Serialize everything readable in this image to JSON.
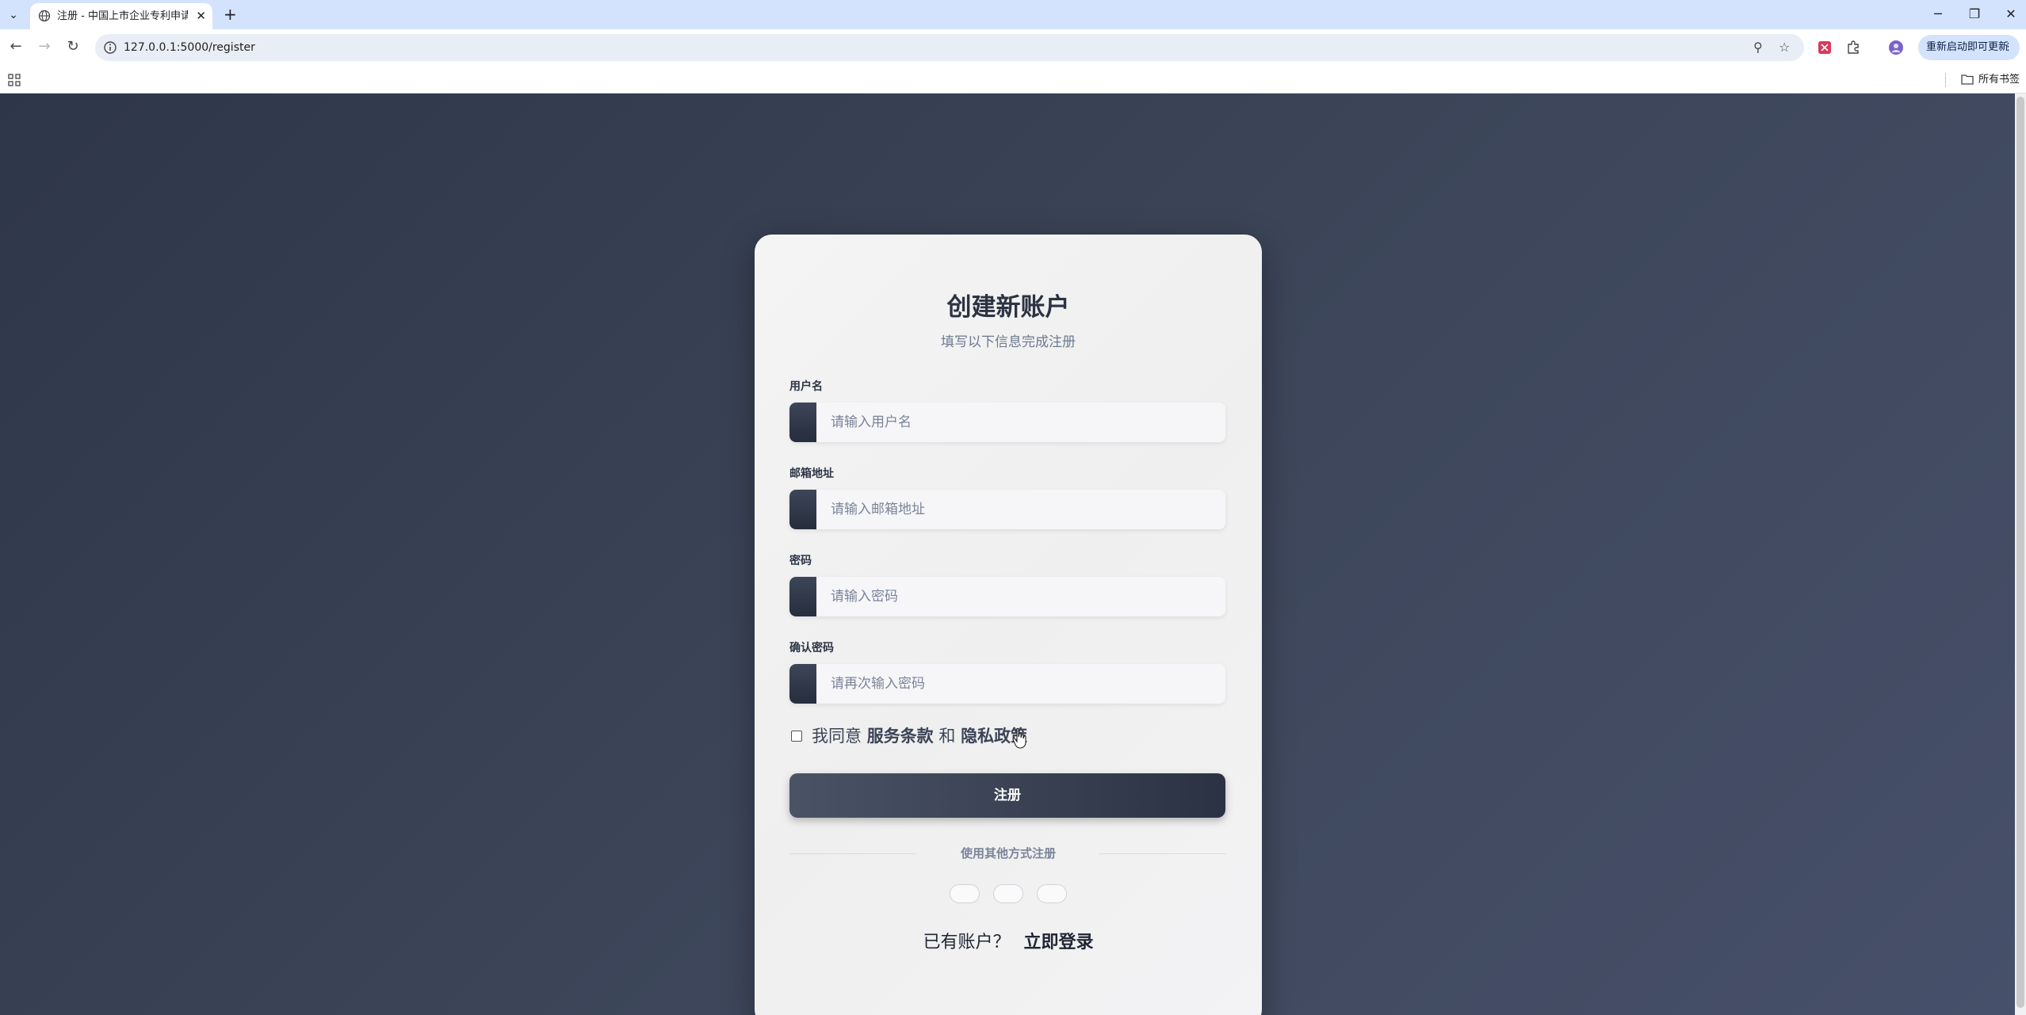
{
  "browser": {
    "tab_title": "注册 - 中国上市企业专利申请数据",
    "url": "127.0.0.1:5000/register",
    "update_button": "重新启动即可更新",
    "bookmarks_all": "所有书签"
  },
  "page": {
    "title": "创建新账户",
    "subtitle": "填写以下信息完成注册",
    "fields": [
      {
        "label": "用户名",
        "placeholder": "请输入用户名"
      },
      {
        "label": "邮箱地址",
        "placeholder": "请输入邮箱地址"
      },
      {
        "label": "密码",
        "placeholder": "请输入密码"
      },
      {
        "label": "确认密码",
        "placeholder": "请再次输入密码"
      }
    ],
    "agree": {
      "prefix": "我同意",
      "terms": "服务条款",
      "and": "和",
      "privacy": "隐私政策"
    },
    "submit_label": "注册",
    "divider_text": "使用其他方式注册",
    "login_prompt": "已有账户？",
    "login_link": "立即登录"
  },
  "colors": {
    "page_background": "#3a4356",
    "card_background": "#f4f4f4",
    "button_dark": "#2b3243",
    "accent_text": "#2c3342"
  }
}
